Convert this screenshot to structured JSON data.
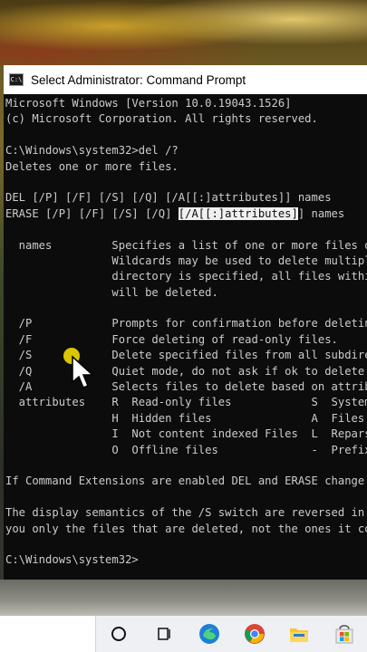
{
  "window": {
    "title": "Select Administrator: Command Prompt",
    "icon": "cmd-icon"
  },
  "console": {
    "lines": [
      "Microsoft Windows [Version 10.0.19043.1526]",
      "(c) Microsoft Corporation. All rights reserved.",
      "",
      "C:\\Windows\\system32>del /?",
      "Deletes one or more files.",
      "",
      "DEL [/P] [/F] [/S] [/Q] [/A[[:]attributes]] names",
      "",
      "",
      "  names         Specifies a list of one or more files or",
      "                Wildcards may be used to delete multipl",
      "                directory is specified, all files withi",
      "                will be deleted.",
      "",
      "  /P            Prompts for confirmation before deletin",
      "  /F            Force deleting of read-only files.",
      "  /S            Delete specified files from all subdire",
      "  /Q            Quiet mode, do not ask if ok to delete",
      "  /A            Selects files to delete based on attrib",
      "  attributes    R  Read-only files            S  System",
      "                H  Hidden files               A  Files",
      "                I  Not content indexed Files  L  Repars",
      "                O  Offline files              -  Prefix",
      "",
      "If Command Extensions are enabled DEL and ERASE change",
      "",
      "The display semantics of the /S switch are reversed in",
      "you only the files that are deleted, not the ones it co",
      "",
      "C:\\Windows\\system32>"
    ],
    "erase_line": {
      "before": "ERASE [/P] [/F] [/S] [/Q] ",
      "selected": "[/A[[:]attributes]",
      "after": "] names"
    }
  },
  "taskbar": {
    "items": [
      "search-box",
      "cortana-icon",
      "task-view-icon",
      "edge-icon",
      "chrome-icon",
      "file-explorer-icon",
      "store-icon"
    ]
  }
}
